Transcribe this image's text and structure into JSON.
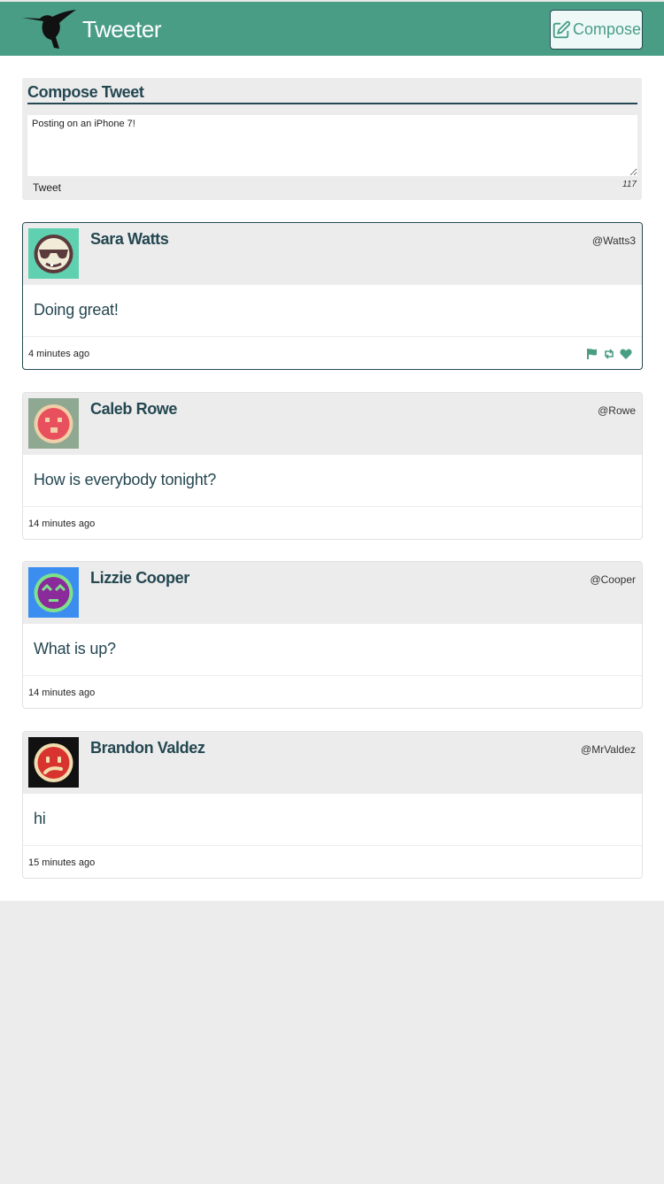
{
  "nav": {
    "brand": "Tweeter",
    "compose_label": "Compose"
  },
  "composer": {
    "title": "Compose Tweet",
    "text": "Posting on an iPhone 7!",
    "submit_label": "Tweet",
    "counter": "117"
  },
  "colors": {
    "accent": "#4a9d85",
    "dark": "#244751",
    "panel": "#ececec"
  },
  "tweets": [
    {
      "name": "Sara Watts",
      "handle": "@Watts3",
      "content": "Doing great!",
      "time": "4 minutes ago",
      "avatar_icon": "sunglasses-face-avatar",
      "avatar_bg": "#5fd0b0",
      "actions": [
        "flag-icon",
        "retweet-icon",
        "heart-icon"
      ]
    },
    {
      "name": "Caleb Rowe",
      "handle": "@Rowe",
      "content": "How is everybody tonight?",
      "time": "14 minutes ago",
      "avatar_icon": "surprised-face-avatar",
      "avatar_bg": "#8fa892"
    },
    {
      "name": "Lizzie Cooper",
      "handle": "@Cooper",
      "content": "What is up?",
      "time": "14 minutes ago",
      "avatar_icon": "happy-face-avatar",
      "avatar_bg": "#3b8ef0"
    },
    {
      "name": "Brandon Valdez",
      "handle": "@MrValdez",
      "content": "hi",
      "time": "15 minutes ago",
      "avatar_icon": "sad-face-avatar",
      "avatar_bg": "#111111"
    }
  ]
}
